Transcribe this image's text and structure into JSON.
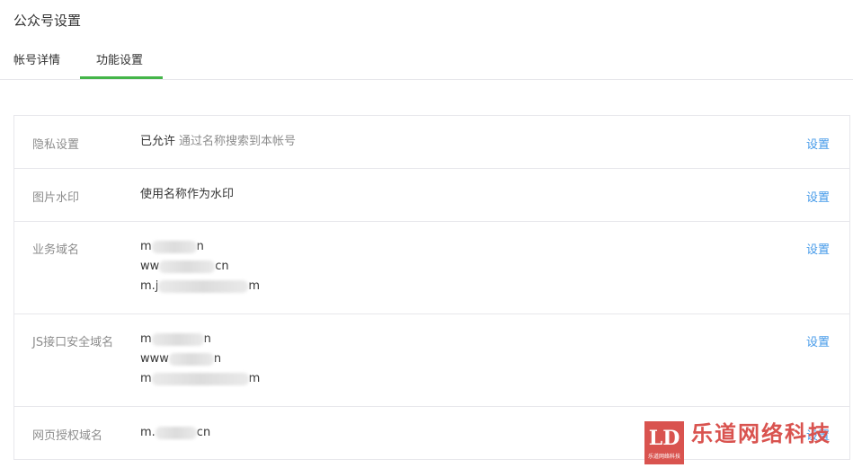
{
  "page": {
    "title": "公众号设置"
  },
  "tabs": [
    {
      "label": "帐号详情",
      "active": false
    },
    {
      "label": "功能设置",
      "active": true
    }
  ],
  "rows": [
    {
      "label": "隐私设置",
      "value": "已允许",
      "desc": "通过名称搜索到本帐号",
      "action": "设置"
    },
    {
      "label": "图片水印",
      "value": "使用名称作为水印",
      "action": "设置"
    },
    {
      "label": "业务域名",
      "domains": [
        {
          "prefix": "m",
          "suffix": "n"
        },
        {
          "prefix": "ww",
          "suffix": "cn"
        },
        {
          "prefix": "m.j",
          "suffix": "m"
        }
      ],
      "action": "设置"
    },
    {
      "label": "JS接口安全域名",
      "domains": [
        {
          "prefix": "m",
          "suffix": "n"
        },
        {
          "prefix": "www",
          "suffix": "n"
        },
        {
          "prefix": "m",
          "suffix": "m"
        }
      ],
      "action": "设置"
    },
    {
      "label": "网页授权域名",
      "domains": [
        {
          "prefix": "m.",
          "suffix": "cn"
        }
      ],
      "action": "设置"
    }
  ],
  "watermark": {
    "badge": "LD",
    "badge_sub": "乐道网络科技",
    "text": "乐道网络科技"
  },
  "colors": {
    "accent_green": "#44b549",
    "link_blue": "#459ae9",
    "watermark_red": "#d9534f"
  }
}
